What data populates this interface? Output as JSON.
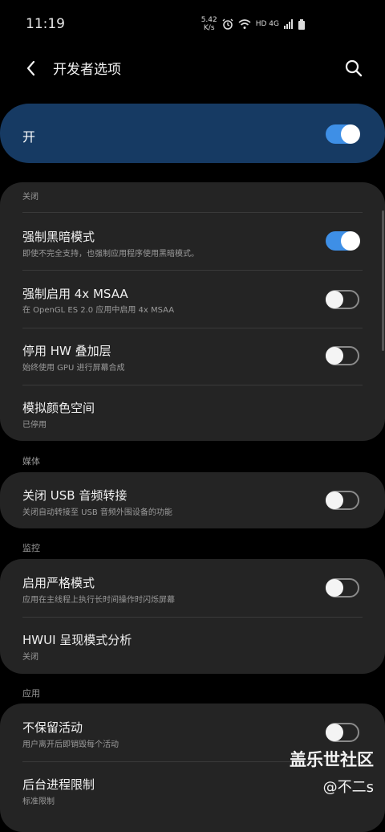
{
  "status": {
    "time": "11:19",
    "speed_value": "5.42",
    "speed_unit": "K/s",
    "network": "HD 4G"
  },
  "header": {
    "title": "开发者选项"
  },
  "master": {
    "label": "开"
  },
  "sections": {
    "media": "媒体",
    "monitor": "监控",
    "apps": "应用"
  },
  "rows": {
    "partial_sub": "关闭",
    "force_dark_title": "强制黑暗模式",
    "force_dark_sub": "即使不完全支持，也强制应用程序使用黑暗模式。",
    "msaa_title": "强制启用 4x MSAA",
    "msaa_sub": "在 OpenGL ES 2.0 应用中启用 4x MSAA",
    "hw_title": "停用 HW 叠加层",
    "hw_sub": "始终使用 GPU 进行屏幕合成",
    "color_title": "模拟颜色空间",
    "color_sub": "已停用",
    "usb_title": "关闭 USB 音频转接",
    "usb_sub": "关闭自动转接至 USB 音频外围设备的功能",
    "strict_title": "启用严格模式",
    "strict_sub": "应用在主线程上执行长时间操作时闪烁屏幕",
    "hwui_title": "HWUI 呈现模式分析",
    "hwui_sub": "关闭",
    "keep_title": "不保留活动",
    "keep_sub": "用户离开后即销毁每个活动",
    "bg_title": "后台进程限制",
    "bg_sub": "标准限制"
  },
  "toggles": {
    "master": true,
    "force_dark": true,
    "msaa": false,
    "hw_overlay": false,
    "usb_audio": false,
    "strict_mode": false,
    "keep_activities": false
  },
  "watermark": {
    "line1": "盖乐世社区",
    "line2": "@不二s"
  },
  "colors": {
    "accent": "#3e8fe6",
    "master_bg": "#163a63",
    "card_bg": "#242424"
  }
}
